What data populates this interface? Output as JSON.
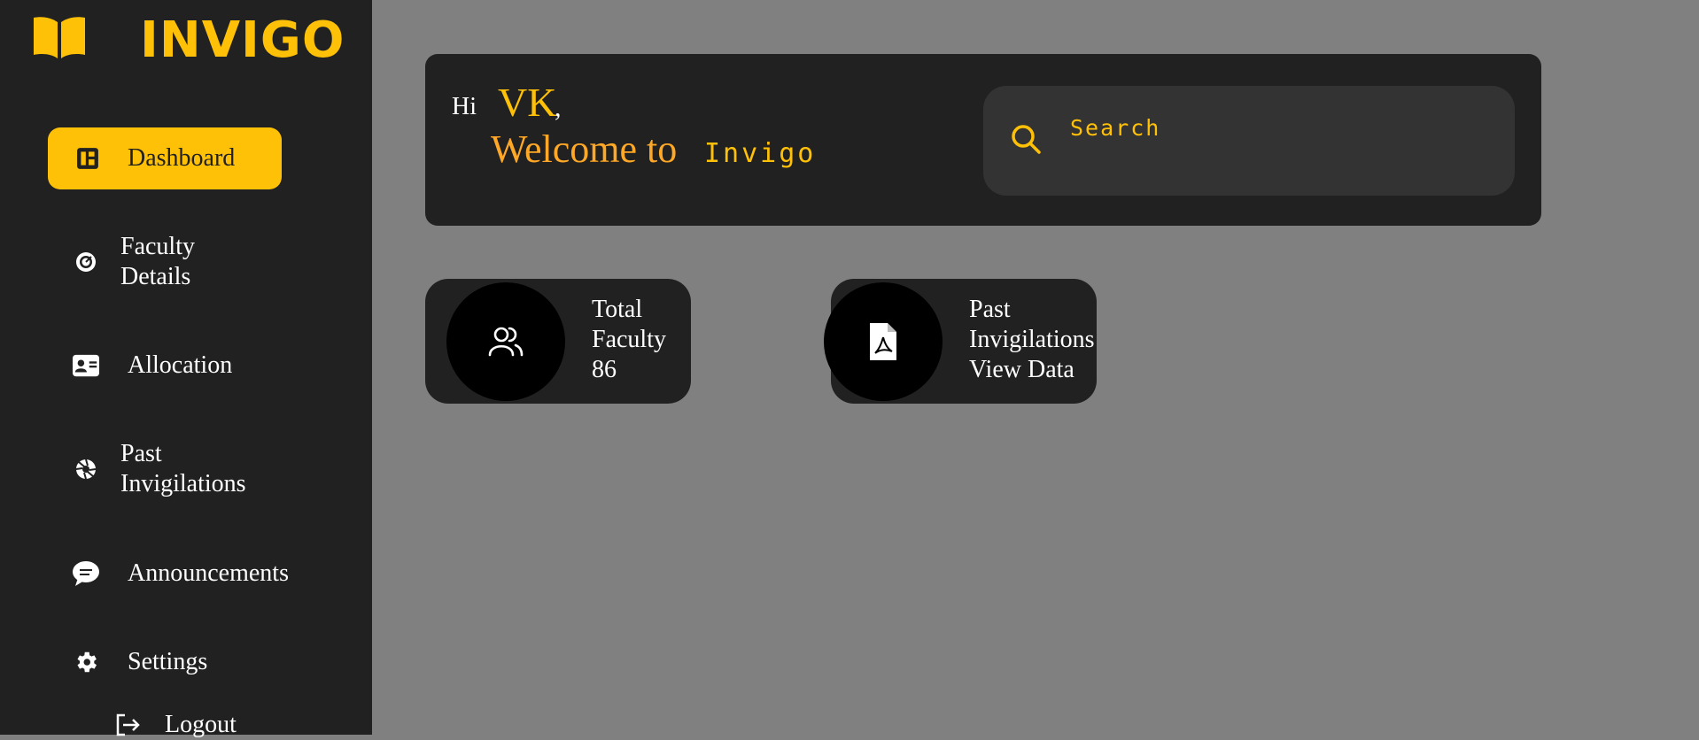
{
  "brand": {
    "name": "INVIGO",
    "icon": "book-open-icon"
  },
  "sidebar": {
    "items": [
      {
        "label": "Dashboard",
        "icon": "dashboard-icon",
        "active": true
      },
      {
        "label": "Faculty Details",
        "line1": "Faculty",
        "line2": "Details",
        "icon": "gauge-icon"
      },
      {
        "label": "Allocation",
        "icon": "id-card-icon"
      },
      {
        "label": "Past Invigilations",
        "line1": "Past",
        "line2": "Invigilations",
        "icon": "aperture-icon"
      },
      {
        "label": "Announcements",
        "icon": "chat-bubble-icon"
      },
      {
        "label": "Settings",
        "icon": "gear-icon"
      },
      {
        "label": "Logout",
        "icon": "logout-icon"
      }
    ]
  },
  "welcome": {
    "greeting": "Hi",
    "username": "VK",
    "comma": ",",
    "message": "Welcome to",
    "app_name": "Invigo"
  },
  "search": {
    "placeholder": "Search"
  },
  "cards": [
    {
      "line1": "Total",
      "line2": "Faculty",
      "line3": "86",
      "icon": "users-icon"
    },
    {
      "line1": "Past",
      "line2": "Invigilations",
      "line3": "View Data",
      "icon": "pdf-file-icon"
    }
  ],
  "colors": {
    "accent": "#ffc107",
    "welcome": "#ffa726",
    "sidebar_bg": "#212121",
    "page_bg": "#808080",
    "search_bg": "#333333"
  }
}
